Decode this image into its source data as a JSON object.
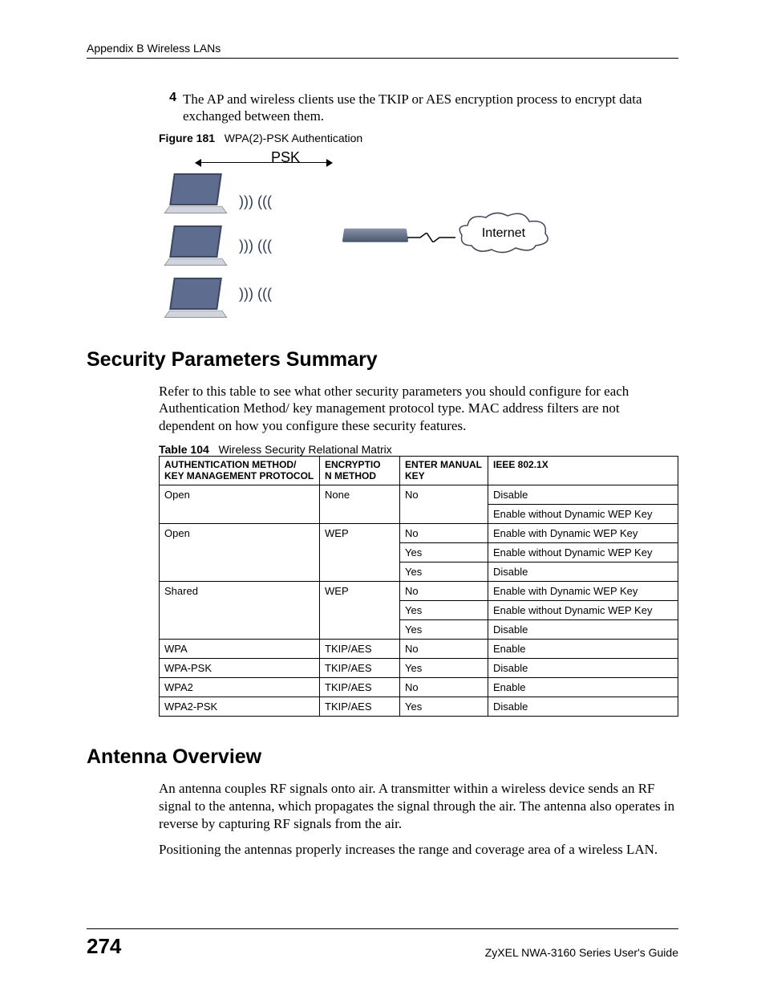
{
  "header": "Appendix B Wireless LANs",
  "list": {
    "num": "4",
    "text": "The AP and wireless clients use the TKIP or AES encryption process to encrypt data exchanged between them."
  },
  "figure": {
    "label": "Figure 181",
    "title": "WPA(2)-PSK Authentication",
    "psk": "PSK",
    "internet": "Internet"
  },
  "section1": {
    "heading": "Security Parameters Summary",
    "para": "Refer to this table to see what other security parameters you should configure for each Authentication Method/ key management protocol type. MAC address filters are not dependent on how you configure these security features."
  },
  "table": {
    "label": "Table 104",
    "title": "Wireless Security Relational Matrix",
    "headers": {
      "c1": "AUTHENTICATION METHOD/ KEY MANAGEMENT PROTOCOL",
      "c2": "ENCRYPTIO\nN METHOD",
      "c3": "ENTER MANUAL KEY",
      "c4": "IEEE 802.1X"
    },
    "rows": [
      {
        "auth": "Open",
        "enc": "None",
        "key": "No",
        "ieee": "Disable",
        "rs_auth": 2,
        "rs_enc": 2
      },
      {
        "key": "",
        "ieee": "Enable without Dynamic WEP Key",
        "hide_key": true
      },
      {
        "auth": "Open",
        "enc": "WEP",
        "key": "No",
        "ieee": "Enable with Dynamic WEP Key",
        "rs_auth": 3,
        "rs_enc": 3
      },
      {
        "key": "Yes",
        "ieee": "Enable without Dynamic WEP Key"
      },
      {
        "key": "Yes",
        "ieee": "Disable"
      },
      {
        "auth": "Shared",
        "enc": "WEP",
        "key": "No",
        "ieee": "Enable with Dynamic WEP Key",
        "rs_auth": 3,
        "rs_enc": 3
      },
      {
        "key": "Yes",
        "ieee": "Enable without Dynamic WEP Key"
      },
      {
        "key": "Yes",
        "ieee": "Disable"
      },
      {
        "auth": "WPA",
        "enc": "TKIP/AES",
        "key": "No",
        "ieee": "Enable"
      },
      {
        "auth": "WPA-PSK",
        "enc": "TKIP/AES",
        "key": "Yes",
        "ieee": "Disable"
      },
      {
        "auth": "WPA2",
        "enc": "TKIP/AES",
        "key": "No",
        "ieee": "Enable"
      },
      {
        "auth": "WPA2-PSK",
        "enc": "TKIP/AES",
        "key": "Yes",
        "ieee": "Disable"
      }
    ]
  },
  "section2": {
    "heading": "Antenna Overview",
    "para1": "An antenna couples RF signals onto air. A transmitter within a wireless device sends an RF signal to the antenna, which propagates the signal through the air. The antenna also operates in reverse by capturing RF signals from the air.",
    "para2": "Positioning the antennas properly increases the range and coverage area of a wireless LAN."
  },
  "footer": {
    "page": "274",
    "guide": "ZyXEL NWA-3160 Series User's Guide"
  }
}
